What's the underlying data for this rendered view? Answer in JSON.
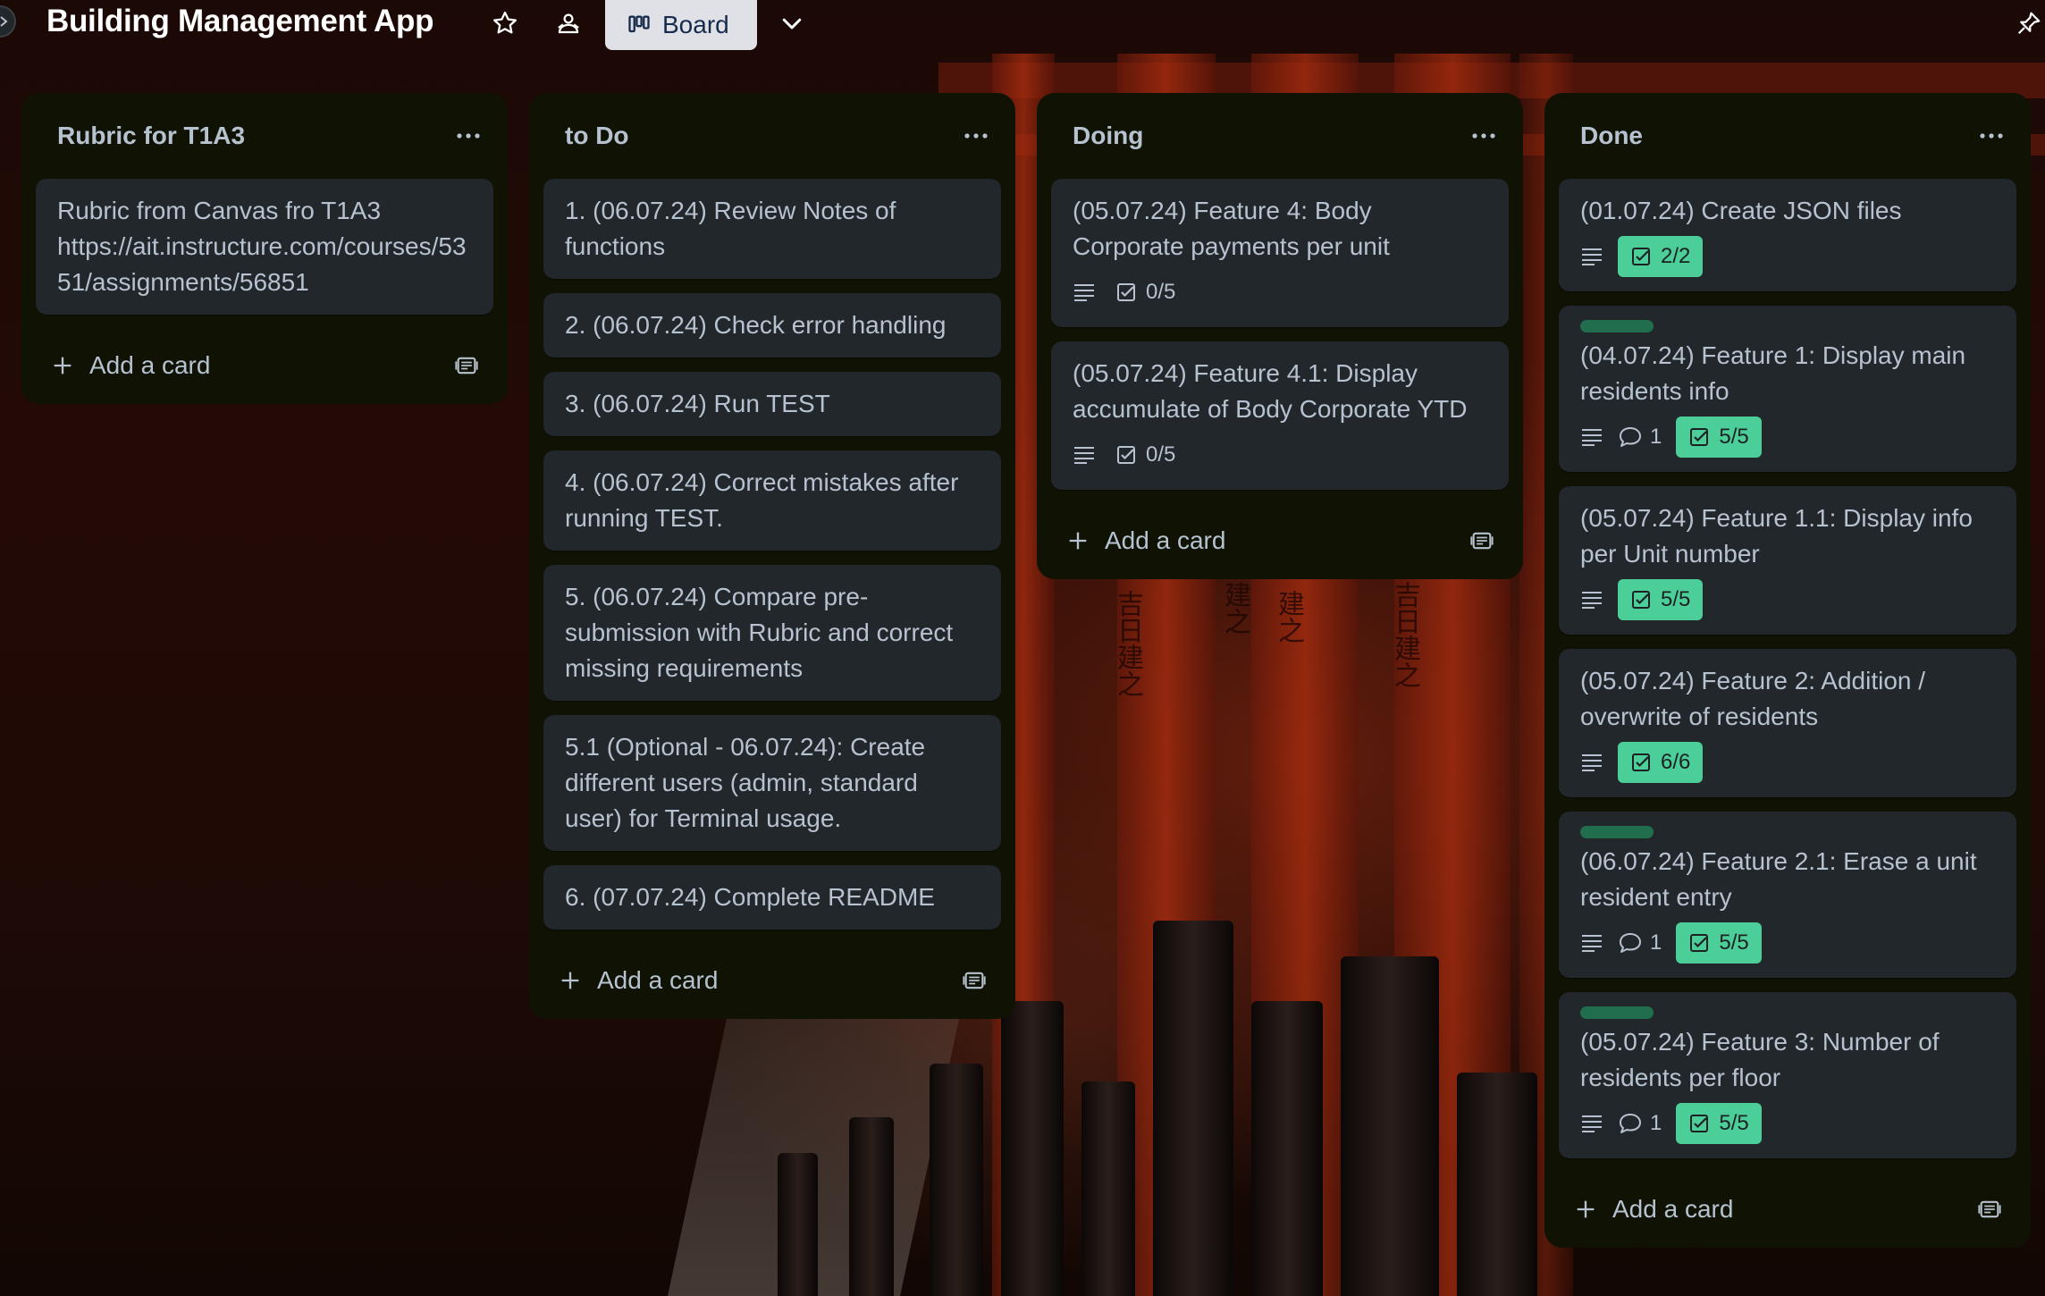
{
  "header": {
    "board_title": "Building Management App",
    "star_icon": "star-icon",
    "visibility_icon": "workspace-visibility-icon",
    "view_button_label": "Board",
    "view_icon": "board-icon",
    "views_dropdown_icon": "chevron-down-icon",
    "right_icon": "pin-icon"
  },
  "lists": [
    {
      "title": "Rubric for T1A3",
      "cards": [
        {
          "title": "Rubric from Canvas fro T1A3 https://ait.instructure.com/courses/5351/assignments/56851"
        }
      ],
      "add_label": "Add a card"
    },
    {
      "title": "to Do",
      "cards": [
        {
          "title": "1. (06.07.24) Review Notes of functions"
        },
        {
          "title": "2. (06.07.24) Check error handling"
        },
        {
          "title": "3. (06.07.24) Run TEST"
        },
        {
          "title": "4. (06.07.24) Correct mistakes after running TEST."
        },
        {
          "title": "5. (06.07.24) Compare pre-submission with Rubric and correct missing requirements"
        },
        {
          "title": "5.1 (Optional - 06.07.24): Create different users (admin, standard user) for Terminal usage."
        },
        {
          "title": "6. (07.07.24) Complete README"
        }
      ],
      "add_label": "Add a card"
    },
    {
      "title": "Doing",
      "cards": [
        {
          "title": "(05.07.24) Feature 4: Body Corporate payments per unit",
          "checklist": "0/5"
        },
        {
          "title": "(05.07.24) Feature 4.1: Display accumulate of Body Corporate YTD",
          "checklist": "0/5"
        }
      ],
      "add_label": "Add a card"
    },
    {
      "title": "Done",
      "cards": [
        {
          "title": "(01.07.24) Create JSON files",
          "checklist": "2/2"
        },
        {
          "title": "(04.07.24) Feature 1: Display main residents info",
          "comments": "1",
          "checklist": "5/5",
          "label_color": "#216e4e"
        },
        {
          "title": "(05.07.24) Feature 1.1: Display info per Unit number",
          "checklist": "5/5"
        },
        {
          "title": "(05.07.24) Feature 2: Addition / overwrite of residents",
          "checklist": "6/6"
        },
        {
          "title": "(06.07.24) Feature 2.1: Erase a unit resident entry",
          "comments": "1",
          "checklist": "5/5",
          "label_color": "#216e4e"
        },
        {
          "title": "(05.07.24) Feature 3: Number of residents per floor",
          "comments": "1",
          "checklist": "5/5",
          "label_color": "#216e4e"
        }
      ],
      "add_label": "Add a card"
    }
  ],
  "colors": {
    "list_bg": "#101204",
    "card_bg": "#22272b",
    "text": "#b6c2cf",
    "checklist_complete": "#4bce97",
    "label_green": "#216e4e"
  }
}
